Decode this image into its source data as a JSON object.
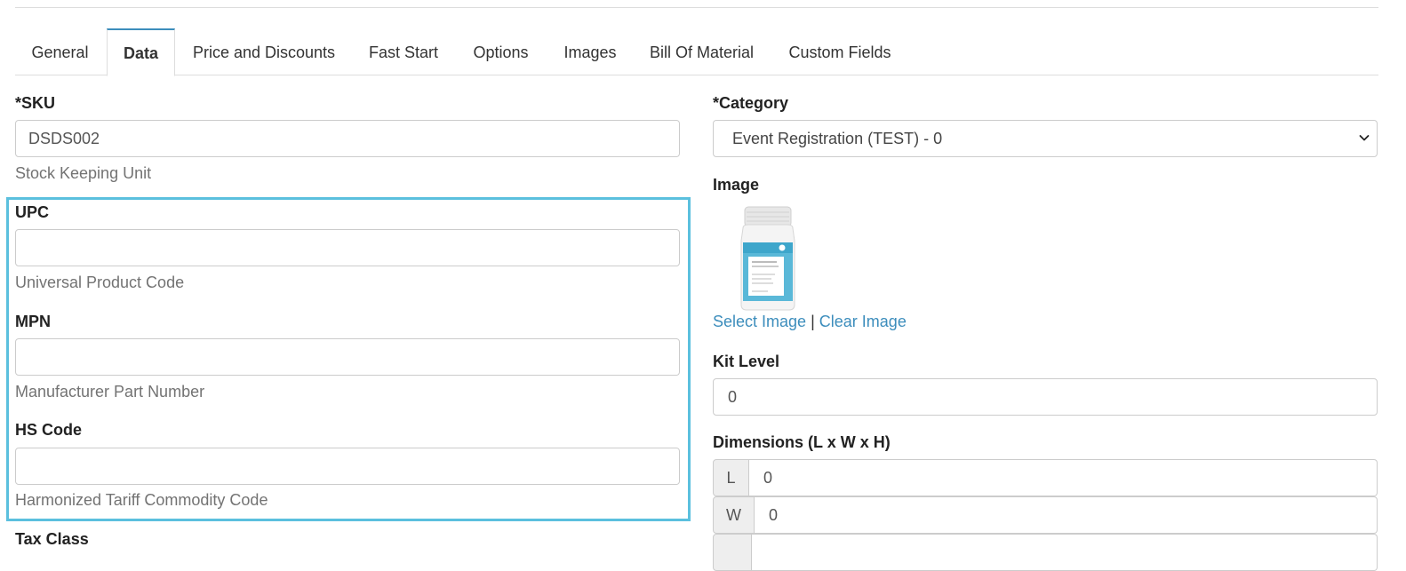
{
  "tabs": [
    {
      "label": "General"
    },
    {
      "label": "Data",
      "active": true
    },
    {
      "label": "Price and Discounts"
    },
    {
      "label": "Fast Start"
    },
    {
      "label": "Options"
    },
    {
      "label": "Images"
    },
    {
      "label": "Bill Of Material"
    },
    {
      "label": "Custom Fields"
    }
  ],
  "fields": {
    "sku": {
      "label": "*SKU",
      "value": "DSDS002",
      "help": "Stock Keeping Unit"
    },
    "upc": {
      "label": "UPC",
      "value": "",
      "help": "Universal Product Code"
    },
    "mpn": {
      "label": "MPN",
      "value": "",
      "help": "Manufacturer Part Number"
    },
    "hs_code": {
      "label": "HS Code",
      "value": "",
      "help": "Harmonized Tariff Commodity Code"
    },
    "tax_class": {
      "label": "Tax Class"
    },
    "category": {
      "label": "*Category",
      "value": "Event Registration (TEST) - 0"
    },
    "image": {
      "label": "Image",
      "select_link": "Select Image",
      "separator": "|",
      "clear_link": "Clear Image"
    },
    "kit_level": {
      "label": "Kit Level",
      "value": "0"
    },
    "dimensions": {
      "label": "Dimensions (L x W x H)",
      "l_addon": "L",
      "l_value": "0",
      "w_addon": "W",
      "w_value": "0"
    }
  },
  "colors": {
    "accent": "#3c8dbc",
    "highlight": "#5bc0de"
  },
  "icons": {
    "select_chevron": "chevron-down-icon"
  }
}
